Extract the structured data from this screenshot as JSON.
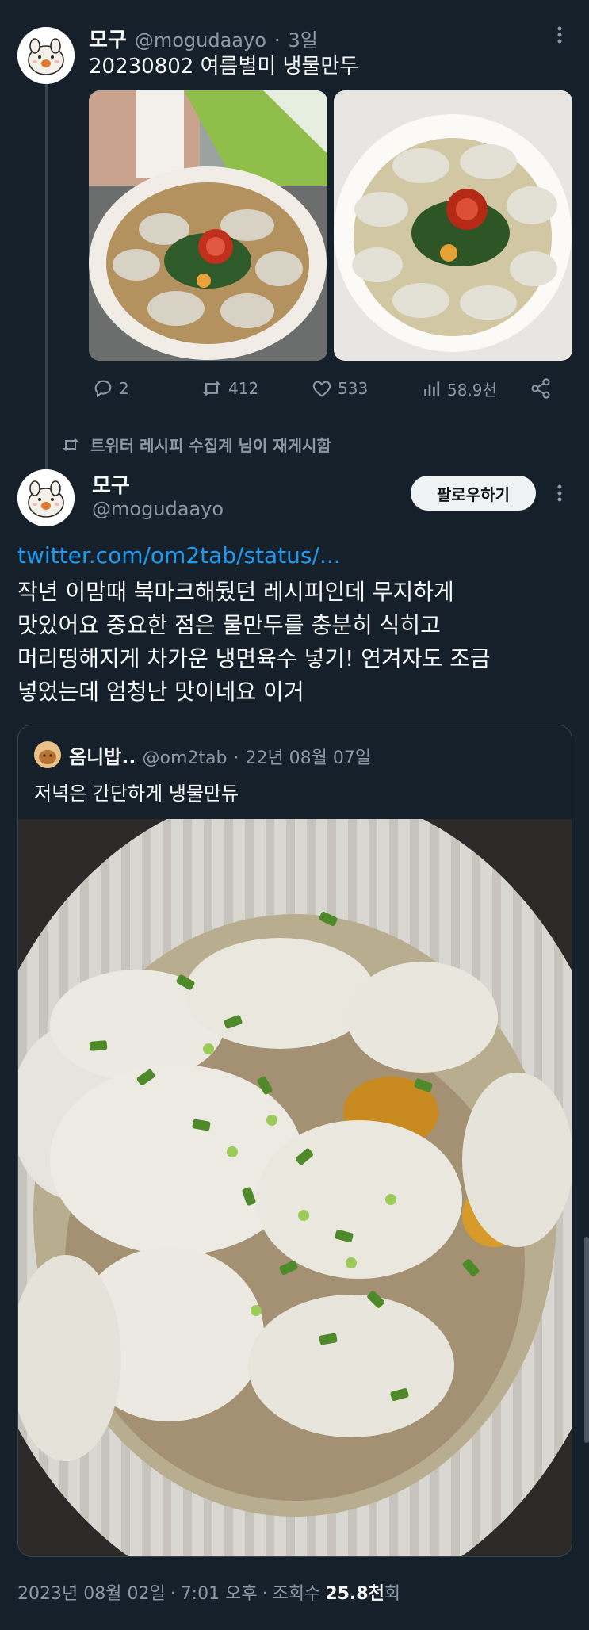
{
  "tweet1": {
    "name": "모구",
    "handle": "@mogudaayo",
    "separator": "·",
    "time": "3일",
    "text": "20230802 여름별미 냉물만두",
    "images": [
      {
        "alt": "bowl of cold mandu soup with tomato (photo 1)"
      },
      {
        "alt": "bowl of cold mandu soup with tomato (photo 2)"
      }
    ],
    "actions": {
      "replies": "2",
      "retweets": "412",
      "likes": "533",
      "views": "58.9천"
    }
  },
  "retweet_context": {
    "text": "트위터 레시피 수집계 님이 재게시함"
  },
  "tweet2": {
    "name": "모구",
    "handle": "@mogudaayo",
    "follow_label": "팔로우하기",
    "link": "twitter.com/om2tab/status/...",
    "lines": [
      "작년 이맘때 북마크해뒀던 레시피인데 무지하게",
      "맛있어요 중요한 점은 물만두를 충분히 식히고",
      "머리띵해지게 차가운 냉면육수 넣기! 연겨자도 조금",
      "넣었는데 엄청난 맛이네요 이거"
    ],
    "quote": {
      "name": "옴니밥..",
      "handle": "@om2tab",
      "separator": "·",
      "date": "22년 08월 07일",
      "text": "저녁은 간단하게 냉물만듀",
      "image": {
        "alt": "dumplings in cold broth with chopped green onions"
      }
    },
    "footer": {
      "date": "2023년 08월 02일",
      "sep1": "·",
      "time": "7:01 오후",
      "sep2": "·",
      "views_label": "조회수",
      "views_value": "25.8천",
      "views_suffix": "회"
    }
  },
  "colors": {
    "background": "#15202b",
    "text_primary": "#f7f9f9",
    "text_secondary": "#8b98a5",
    "link": "#1d9bf0",
    "border": "#38444d"
  },
  "icons": [
    "kebab-menu-icon",
    "reply-icon",
    "retweet-icon",
    "like-icon",
    "views-icon",
    "share-icon"
  ]
}
